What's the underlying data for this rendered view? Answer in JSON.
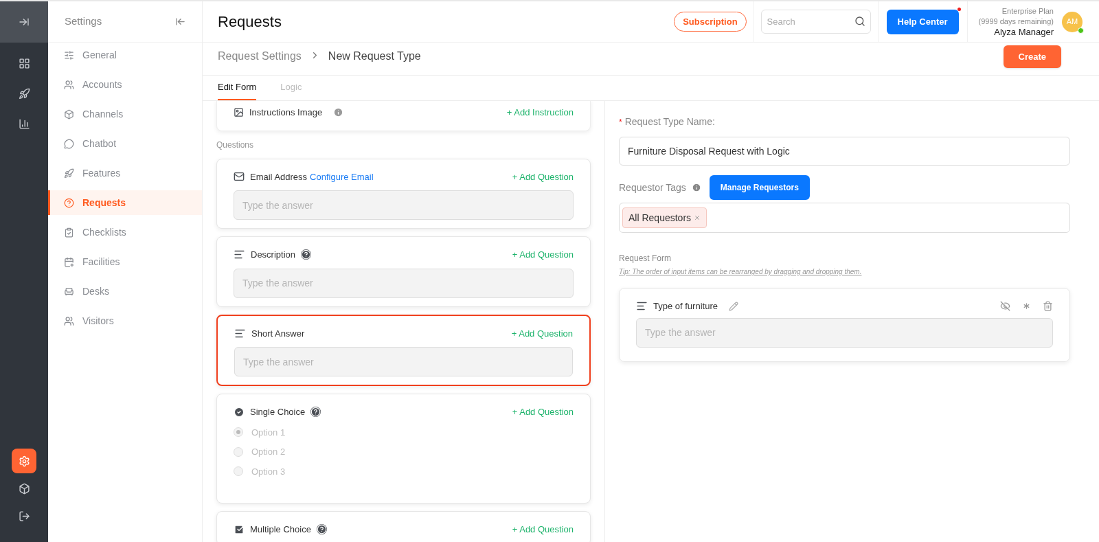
{
  "rail": {
    "items": [
      {
        "kind": "dashboard",
        "selected": false
      },
      {
        "kind": "rocket",
        "selected": false
      },
      {
        "kind": "chart",
        "selected": false
      }
    ],
    "bottom_items": [
      {
        "kind": "settings",
        "selected": true
      },
      {
        "kind": "box",
        "selected": false
      },
      {
        "kind": "exit",
        "selected": false
      }
    ]
  },
  "settings_nav": {
    "title": "Settings",
    "items": [
      {
        "label": "General",
        "selected": false
      },
      {
        "label": "Accounts",
        "selected": false
      },
      {
        "label": "Channels",
        "selected": false
      },
      {
        "label": "Chatbot",
        "selected": false
      },
      {
        "label": "Features",
        "selected": false
      },
      {
        "label": "Requests",
        "selected": true
      },
      {
        "label": "Checklists",
        "selected": false
      },
      {
        "label": "Facilities",
        "selected": false
      },
      {
        "label": "Desks",
        "selected": false
      },
      {
        "label": "Visitors",
        "selected": false
      }
    ]
  },
  "header": {
    "title": "Requests",
    "subscription": "Subscription",
    "search": {
      "placeholder": "Search"
    },
    "help_center": "Help Center",
    "plan": "Enterprise Plan",
    "remaining": "(9999 days remaining)",
    "user": "Alyza Manager",
    "avatar": "AM"
  },
  "breadcrumb": [
    "Request Settings",
    "New Request Type"
  ],
  "create_button": "Create",
  "tabs": [
    {
      "label": "Edit Form",
      "selected": true
    },
    {
      "label": "Logic",
      "selected": false
    }
  ],
  "instructions": {
    "label": "Instructions Image",
    "action": "+ Add Instruction"
  },
  "questions_heading": "Questions",
  "questions": [
    {
      "kind": "email",
      "label": "Email Address",
      "link": "Configure Email",
      "help": false,
      "action": "+ Add Question",
      "placeholder": "Type the answer",
      "highlighted": false
    },
    {
      "kind": "text",
      "label": "Description",
      "help": true,
      "action": "+ Add Question",
      "placeholder": "Type the answer",
      "highlighted": false
    },
    {
      "kind": "text",
      "label": "Short Answer",
      "help": false,
      "action": "+ Add Question",
      "placeholder": "Type the answer",
      "highlighted": true
    },
    {
      "kind": "single",
      "label": "Single Choice",
      "help": true,
      "action": "+ Add Question",
      "highlighted": false,
      "options": [
        {
          "label": "Option 1",
          "selected": true
        },
        {
          "label": "Option 2",
          "selected": false
        },
        {
          "label": "Option 3",
          "selected": false
        }
      ]
    },
    {
      "kind": "multiple",
      "label": "Multiple Choice",
      "help": true,
      "action": "+ Add Question",
      "highlighted": false
    }
  ],
  "form": {
    "required_mark": "*",
    "name_label": "Request Type Name",
    "name_colon": ":",
    "name_value": "Furniture Disposal Request with Logic",
    "tags_label": "Requestor Tags",
    "manage_button": "Manage Requestors",
    "tags": [
      "All Requestors"
    ],
    "form_heading": "Request Form",
    "tip": "Tip: The order of input items can be rearranged by dragging and dropping them.",
    "items": [
      {
        "label": "Type of furniture",
        "placeholder": "Type the answer"
      }
    ]
  }
}
